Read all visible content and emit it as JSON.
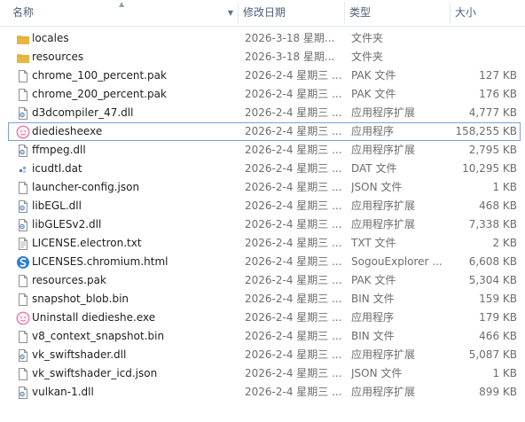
{
  "columns": {
    "name": "名称",
    "modified": "修改日期",
    "type": "类型",
    "size": "大小"
  },
  "files": [
    {
      "name": "locales",
      "modified": "2026-3-18 星期...",
      "type": "文件夹",
      "size": "",
      "icon": "folder-icon"
    },
    {
      "name": "resources",
      "modified": "2026-3-18 星期...",
      "type": "文件夹",
      "size": "",
      "icon": "folder-icon"
    },
    {
      "name": "chrome_100_percent.pak",
      "modified": "2026-2-4 星期三 ...",
      "type": "PAK 文件",
      "size": "127 KB",
      "icon": "file-icon"
    },
    {
      "name": "chrome_200_percent.pak",
      "modified": "2026-2-4 星期三 ...",
      "type": "PAK 文件",
      "size": "176 KB",
      "icon": "file-icon"
    },
    {
      "name": "d3dcompiler_47.dll",
      "modified": "2026-2-4 星期三 ...",
      "type": "应用程序扩展",
      "size": "4,777 KB",
      "icon": "dll-icon"
    },
    {
      "name": "diediesheexe",
      "modified": "2026-2-4 星期三 ...",
      "type": "应用程序",
      "size": "158,255 KB",
      "icon": "app-icon"
    },
    {
      "name": "ffmpeg.dll",
      "modified": "2026-2-4 星期三 ...",
      "type": "应用程序扩展",
      "size": "2,795 KB",
      "icon": "dll-icon"
    },
    {
      "name": "icudtl.dat",
      "modified": "2026-2-4 星期三 ...",
      "type": "DAT 文件",
      "size": "10,295 KB",
      "icon": "dat-icon"
    },
    {
      "name": "launcher-config.json",
      "modified": "2026-2-4 星期三 ...",
      "type": "JSON 文件",
      "size": "1 KB",
      "icon": "file-icon"
    },
    {
      "name": "libEGL.dll",
      "modified": "2026-2-4 星期三 ...",
      "type": "应用程序扩展",
      "size": "468 KB",
      "icon": "dll-icon"
    },
    {
      "name": "libGLESv2.dll",
      "modified": "2026-2-4 星期三 ...",
      "type": "应用程序扩展",
      "size": "7,338 KB",
      "icon": "dll-icon"
    },
    {
      "name": "LICENSE.electron.txt",
      "modified": "2026-2-4 星期三 ...",
      "type": "TXT 文件",
      "size": "2 KB",
      "icon": "text-file-icon"
    },
    {
      "name": "LICENSES.chromium.html",
      "modified": "2026-2-4 星期三 ...",
      "type": "SogouExplorer ...",
      "size": "6,608 KB",
      "icon": "browser-icon"
    },
    {
      "name": "resources.pak",
      "modified": "2026-2-4 星期三 ...",
      "type": "PAK 文件",
      "size": "5,304 KB",
      "icon": "file-icon"
    },
    {
      "name": "snapshot_blob.bin",
      "modified": "2026-2-4 星期三 ...",
      "type": "BIN 文件",
      "size": "159 KB",
      "icon": "file-icon"
    },
    {
      "name": "Uninstall diedieshe.exe",
      "modified": "2026-2-4 星期三 ...",
      "type": "应用程序",
      "size": "179 KB",
      "icon": "app-icon"
    },
    {
      "name": "v8_context_snapshot.bin",
      "modified": "2026-2-4 星期三 ...",
      "type": "BIN 文件",
      "size": "466 KB",
      "icon": "file-icon"
    },
    {
      "name": "vk_swiftshader.dll",
      "modified": "2026-2-4 星期三 ...",
      "type": "应用程序扩展",
      "size": "5,087 KB",
      "icon": "dll-icon"
    },
    {
      "name": "vk_swiftshader_icd.json",
      "modified": "2026-2-4 星期三 ...",
      "type": "JSON 文件",
      "size": "1 KB",
      "icon": "file-icon"
    },
    {
      "name": "vulkan-1.dll",
      "modified": "2026-2-4 星期三 ...",
      "type": "应用程序扩展",
      "size": "899 KB",
      "icon": "dll-icon"
    }
  ],
  "selected_index": 5,
  "colors": {
    "header_text": "#4c607a",
    "selection_border": "#7da2ce",
    "folder": "#e8b53e",
    "app_icon": "#e56aa6"
  }
}
